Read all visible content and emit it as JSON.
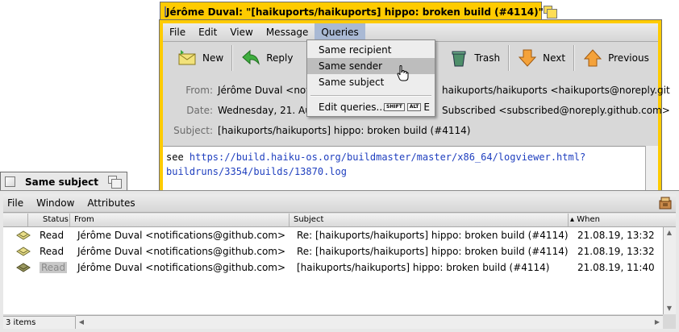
{
  "mail_window": {
    "title": "Jérôme Duval: \"[haikuports/haikuports] hippo: broken build (#4114)\"",
    "menu": [
      "File",
      "Edit",
      "View",
      "Message",
      "Queries"
    ],
    "toolbar": {
      "new_label": "New",
      "reply_label": "Reply",
      "trash_label": "Trash",
      "next_label": "Next",
      "previous_label": "Previous"
    },
    "header": {
      "from_label": "From:",
      "from_value": "Jérôme Duval <notific",
      "to_value": "haikuports/haikuports <haikuports@noreply.git",
      "date_label": "Date:",
      "date_value": "Wednesday, 21. Augu",
      "cc_value": "Subscribed <subscribed@noreply.github.com>",
      "subject_label": "Subject:",
      "subject_value": "[haikuports/haikuports] hippo: broken build (#4114)"
    },
    "body": {
      "prefix": "see ",
      "link_line1": "https://build.haiku-os.org/buildmaster/master/x86_64/logviewer.html?",
      "link_line2": "buildruns/3354/builds/13870.log"
    }
  },
  "queries_menu": {
    "items": [
      "Same recipient",
      "Same sender",
      "Same subject"
    ],
    "highlighted": "Same sender",
    "edit_label": "Edit queries...",
    "shortcut_shift": "SHIFT",
    "shortcut_alt": "ALT",
    "shortcut_key": "E"
  },
  "query_window": {
    "title": "Same subject",
    "menu": [
      "File",
      "Window",
      "Attributes"
    ],
    "columns": {
      "status": "Status",
      "from": "From",
      "subject": "Subject",
      "when": "When"
    },
    "rows": [
      {
        "status": "Read",
        "from": "Jérôme Duval <notifications@github.com>",
        "subject": "Re: [haikuports/haikuports] hippo: broken build (#4114)",
        "when": "21.08.19, 13:32"
      },
      {
        "status": "Read",
        "from": "Jérôme Duval <notifications@github.com>",
        "subject": "Re: [haikuports/haikuports] hippo: broken build (#4114)",
        "when": "21.08.19, 13:32"
      },
      {
        "status": "Read",
        "from": "Jérôme Duval <notifications@github.com>",
        "subject": "[haikuports/haikuports] hippo: broken build (#4114)",
        "when": "21.08.19, 11:40"
      }
    ],
    "status_text": "3 items"
  },
  "colors": {
    "active_tab": "#ffcb00",
    "inactive_tab": "#e8e8e8",
    "link": "#1f3fbf",
    "menu_highlight": "#bdbdbd"
  }
}
